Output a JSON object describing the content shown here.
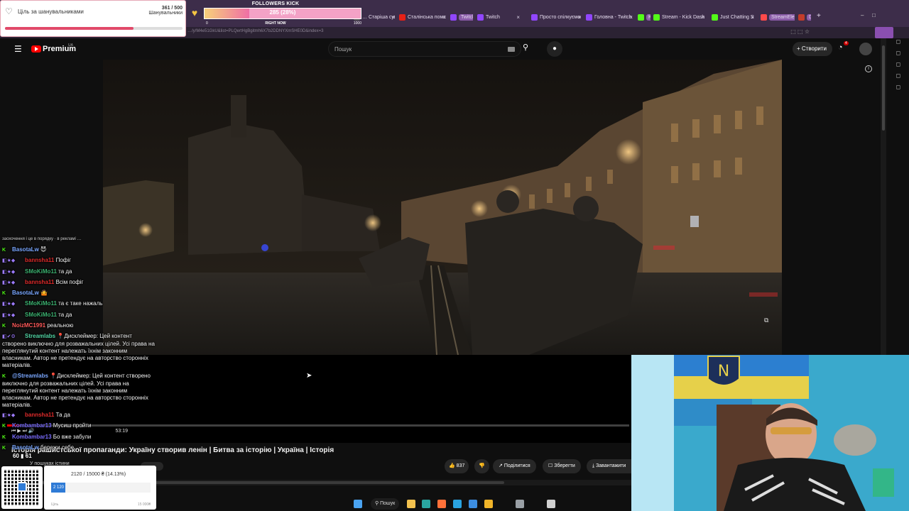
{
  "browser": {
    "tabs": [
      {
        "label": "… Старіша сумміс",
        "color": "#5c5c5c"
      },
      {
        "label": "Сталінська помста",
        "color": "#e62117"
      },
      {
        "label": "TwitchTV",
        "color": "#9146ff",
        "pill": true
      },
      {
        "label": "Twitch",
        "color": "#9146ff"
      },
      {
        "label": "Просто спілкуємос",
        "color": "#9146ff"
      },
      {
        "label": "Головна - Twitch",
        "color": "#9146ff"
      },
      {
        "label": "KICK",
        "color": "#53fc18",
        "pill": true
      },
      {
        "label": "Stream - Kick Dash",
        "color": "#53fc18"
      },
      {
        "label": "Just Chatting Strea",
        "color": "#53fc18"
      },
      {
        "label": "StreamElements",
        "color": "#ff4a4a",
        "pill": true
      },
      {
        "label": "Dota2",
        "color": "#c23c2a",
        "pill": true
      }
    ],
    "close_glyph": "×",
    "newtab_glyph": "+",
    "url": "…/y/M4e51GkU&list=PLQertHgBgitmh6X7b2DDNYXmSHE0D&index=3"
  },
  "youtube": {
    "logo": "Premium",
    "logo_suffix": "UA",
    "search_placeholder": "Пошук",
    "create_label": "Створити",
    "notif_count": "4",
    "video_title": "Історія рашистської пропаганди: Україну створив ленін | Битва за історію | Україна | Історія",
    "channel": "У пошуках істини",
    "time": "53:19",
    "progress_fraction": 0.02,
    "likes": "837",
    "share_label": "Поділитися",
    "save_label": "Зберегти",
    "download_label": "Завантажити",
    "icons": {
      "menu": "☰",
      "search": "⚲",
      "mic": "🎤",
      "bell": "🔔",
      "info": "i",
      "like": "👍",
      "dislike": "👎",
      "share": "↗",
      "save": "☐",
      "download": "⤓",
      "plus": "+",
      "cursor": "➤",
      "corner": "⧉"
    }
  },
  "overlays": {
    "follow_goal": {
      "label": "Ціль за шанувальниками",
      "count": "361 / 500",
      "unit": "Шанувальники",
      "fraction": 0.722,
      "heart_icon": "♡"
    },
    "kick": {
      "title": "FOLLOWERS KICK",
      "value": "285 (28%)",
      "fraction": 0.285,
      "min": "0",
      "caption": "RIGHT NOW",
      "max": "1000",
      "heart_icon": "♥"
    },
    "donation": {
      "text": "2120 / 15000 ₴ (14.13%)",
      "fill_label": "2 120",
      "fraction": 0.1413,
      "label": "Ціль",
      "max": "15 000₴"
    },
    "viewers": "60  ▮ 61"
  },
  "chat": {
    "cut_text": "заохочення і це в порядку · в рекламі … ",
    "messages": [
      {
        "badges": "K",
        "user": "BasotaLw",
        "color": "#7aa7ff",
        "text": "😈"
      },
      {
        "badges": "◧★◆",
        "user": "bannsha11",
        "color": "#e02b2b",
        "text": "Пофіг"
      },
      {
        "badges": "◧★◆",
        "user": "SMoKiMo11",
        "color": "#3cb371",
        "text": "та да"
      },
      {
        "badges": "◧★◆",
        "user": "bannsha11",
        "color": "#e02b2b",
        "text": "Всім пофіг"
      },
      {
        "badges": "K",
        "user": "BasotaLw",
        "color": "#7aa7ff",
        "text": "🤷"
      },
      {
        "badges": "◧★◆",
        "user": "SMoKiMo11",
        "color": "#3cb371",
        "text": "та є таке нажаль"
      },
      {
        "badges": "◧★◆",
        "user": "SMoKiMo11",
        "color": "#3cb371",
        "text": "та да"
      },
      {
        "badges": "K",
        "user": "NoizMC1991",
        "color": "#ff5a5a",
        "text": "реальною"
      },
      {
        "badges": "◧✔⚙",
        "user": "Streamlabs",
        "color": "#53d6a6",
        "text": "📍Дисклеймер: Цей контент створено виключно для розважальних цілей. Усі права на переглянутий контент належать їхнім законним власникам. Автор не претендує на авторство сторонніх матеріалів."
      },
      {
        "badges": "K",
        "user": "@Streamlabs",
        "color": "#7aa7ff",
        "text": "📍Дисклеймер: Цей контент створено виключно для розважальних цілей. Усі права на переглянутий контент належать їхнім законним власникам. Автор не претендує на авторство сторонніх матеріалів."
      },
      {
        "badges": "◧★◆",
        "user": "bannsha11",
        "color": "#e02b2b",
        "text": "Та да"
      },
      {
        "badges": "K",
        "user": "Kombambar13",
        "color": "#7a6cff",
        "text": "Мусиш пройти"
      },
      {
        "badges": "K",
        "user": "Kombambar13",
        "color": "#7a6cff",
        "text": "Бо вже забули"
      },
      {
        "badges": "K",
        "user": "BasotaLw",
        "color": "#7aa7ff",
        "text": "бережи себе"
      }
    ]
  },
  "taskbar": {
    "search_label": "Пошук",
    "apps": [
      {
        "name": "windows-start-icon",
        "color": "#4aa3f0"
      },
      {
        "name": "file-explorer-icon",
        "color": "#f2c14e"
      },
      {
        "name": "edge-icon",
        "color": "#2aa5a0"
      },
      {
        "name": "firefox-icon",
        "color": "#ff7139"
      },
      {
        "name": "telegram-icon",
        "color": "#2aa3e0"
      },
      {
        "name": "vscode-icon",
        "color": "#3c8de0"
      },
      {
        "name": "chrome-icon",
        "color": "#f0b429"
      },
      {
        "name": "settings-icon",
        "color": "#9aa0a6"
      },
      {
        "name": "obs-icon",
        "color": "#d0d0d0"
      }
    ]
  }
}
